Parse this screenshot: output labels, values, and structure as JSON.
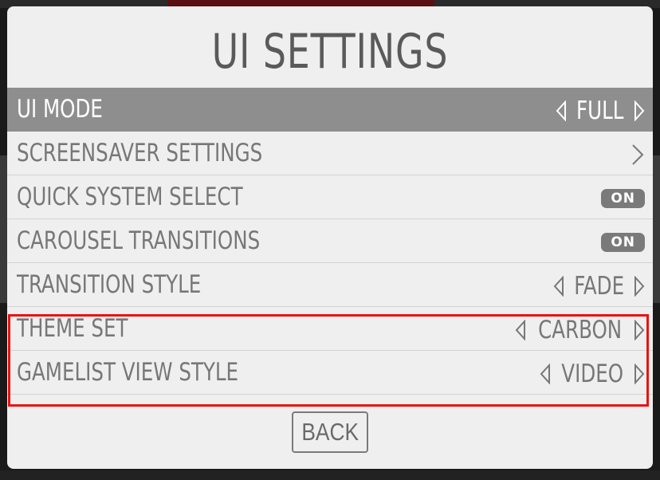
{
  "dialog": {
    "title": "UI SETTINGS",
    "back_label": "BACK"
  },
  "rows": [
    {
      "label": "UI MODE",
      "type": "option",
      "value": "FULL",
      "selected": true
    },
    {
      "label": "SCREENSAVER SETTINGS",
      "type": "submenu"
    },
    {
      "label": "QUICK SYSTEM SELECT",
      "type": "toggle",
      "value": "ON"
    },
    {
      "label": "CAROUSEL TRANSITIONS",
      "type": "toggle",
      "value": "ON"
    },
    {
      "label": "TRANSITION STYLE",
      "type": "option",
      "value": "FADE"
    },
    {
      "label": "THEME SET",
      "type": "option",
      "value": "CARBON"
    },
    {
      "label": "GAMELIST VIEW STYLE",
      "type": "option",
      "value": "VIDEO"
    }
  ],
  "icons": {
    "left": "triangle-left-icon",
    "right": "triangle-right-icon",
    "submenu": "chevron-right-icon"
  },
  "colors": {
    "selected_row": "#8e8e8e",
    "dialog_bg": "#efefef",
    "highlight": "#ee1111",
    "text": "#777777",
    "toggle_bg": "#7a7a7a"
  }
}
